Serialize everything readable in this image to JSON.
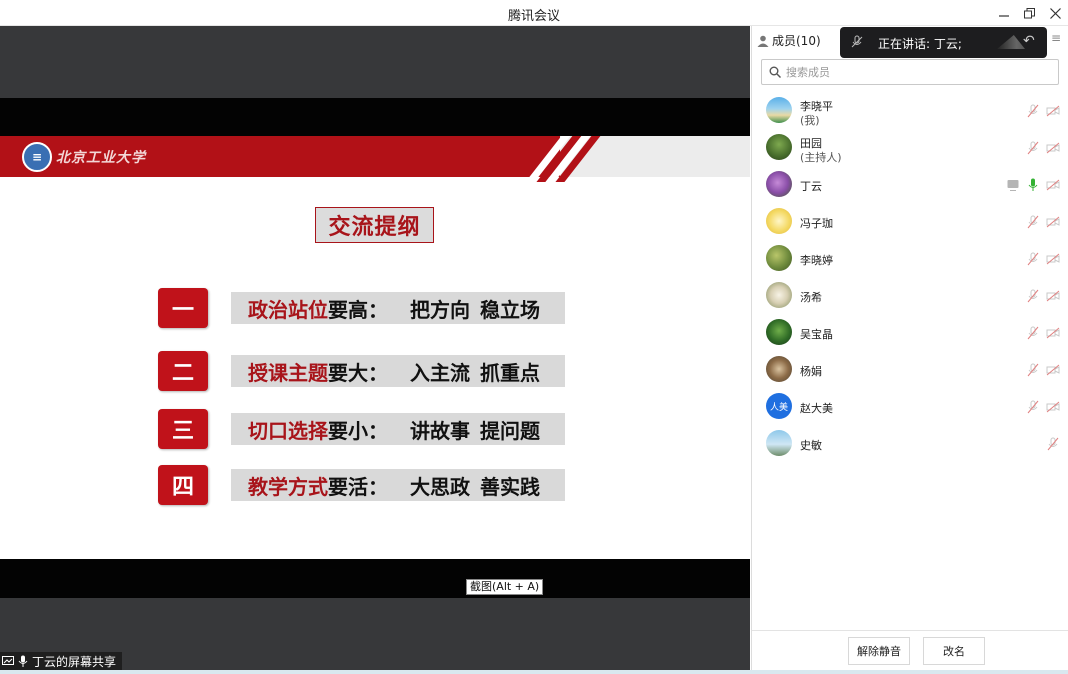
{
  "window": {
    "title": "腾讯会议"
  },
  "stage": {
    "slide": {
      "logo_text": "北京工业大学",
      "title": "交流提纲",
      "rows": [
        {
          "num": "一",
          "highlight": "政治站位",
          "rest": "要高：",
          "a": "把方向",
          "b": "稳立场"
        },
        {
          "num": "二",
          "highlight": "授课主题",
          "rest": "要大：",
          "a": "入主流",
          "b": "抓重点"
        },
        {
          "num": "三",
          "highlight": "切口选择",
          "rest": "要小：",
          "a": "讲故事",
          "b": "提问题"
        },
        {
          "num": "四",
          "highlight": "教学方式",
          "rest": "要活：",
          "a": "大思政",
          "b": "善实践"
        }
      ]
    },
    "screenshot_tip": "截图(Alt + A)",
    "share_label": "丁云的屏幕共享"
  },
  "panel": {
    "members_tab": "成员(10)",
    "speaking": "正在讲话: 丁云;",
    "search_placeholder": "搜索成员",
    "members": [
      {
        "name": "李晓平",
        "role": "(我)",
        "avatar": "landscape-sea"
      },
      {
        "name": "田园",
        "role": "(主持人)",
        "avatar": "tree-forest"
      },
      {
        "name": "丁云",
        "role": "",
        "avatar": "purple-flowers"
      },
      {
        "name": "冯子珈",
        "role": "",
        "avatar": "yellow-cartoon"
      },
      {
        "name": "李晓婷",
        "role": "",
        "avatar": "green-leaves"
      },
      {
        "name": "汤希",
        "role": "",
        "avatar": "white-flowers"
      },
      {
        "name": "吴宝晶",
        "role": "",
        "avatar": "green-plant"
      },
      {
        "name": "杨娟",
        "role": "",
        "avatar": "bird-branch"
      },
      {
        "name": "赵大美",
        "role": "",
        "avatar": "blue-initials",
        "avatar_text": "人美"
      },
      {
        "name": "史敏",
        "role": "",
        "avatar": "sky-tower"
      }
    ],
    "buttons": {
      "unmute_all": "解除静音",
      "rename": "改名"
    }
  },
  "colors": {
    "slide_red": "#b21117",
    "dark_bg": "#37383a",
    "speaking_bg": "#1d1d1f",
    "active_mic": "#34b233"
  }
}
